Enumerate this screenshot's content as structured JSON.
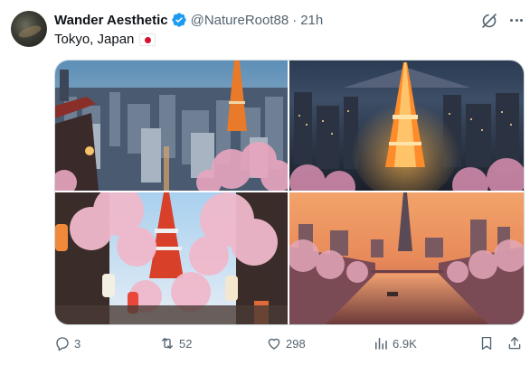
{
  "post": {
    "author": {
      "name": "Wander Aesthetic",
      "handle": "@NatureRoot88",
      "separator": "·",
      "time": "21h",
      "avatar_icon": "avatar-image",
      "verified_icon": "verified-badge-icon",
      "verified_color": "#1d9bf0"
    },
    "text": "Tokyo, Japan",
    "flag_icon": "japan-flag-emoji",
    "media": [
      {
        "icon": "photo-tokyo-tower-daytime-cityscape"
      },
      {
        "icon": "photo-tokyo-tower-night-illuminated"
      },
      {
        "icon": "photo-tokyo-tower-cherry-blossom-street"
      },
      {
        "icon": "photo-tokyo-river-sunset-skytree"
      }
    ],
    "actions": {
      "replies": "3",
      "reposts": "52",
      "likes": "298",
      "views": "6.9K"
    },
    "icons": [
      "grok-icon",
      "more-icon",
      "reply-icon",
      "repost-icon",
      "like-icon",
      "views-icon",
      "bookmark-icon",
      "share-icon"
    ],
    "colors": {
      "text": "#0f1419",
      "secondary": "#536471",
      "border": "#cfd9de"
    }
  }
}
